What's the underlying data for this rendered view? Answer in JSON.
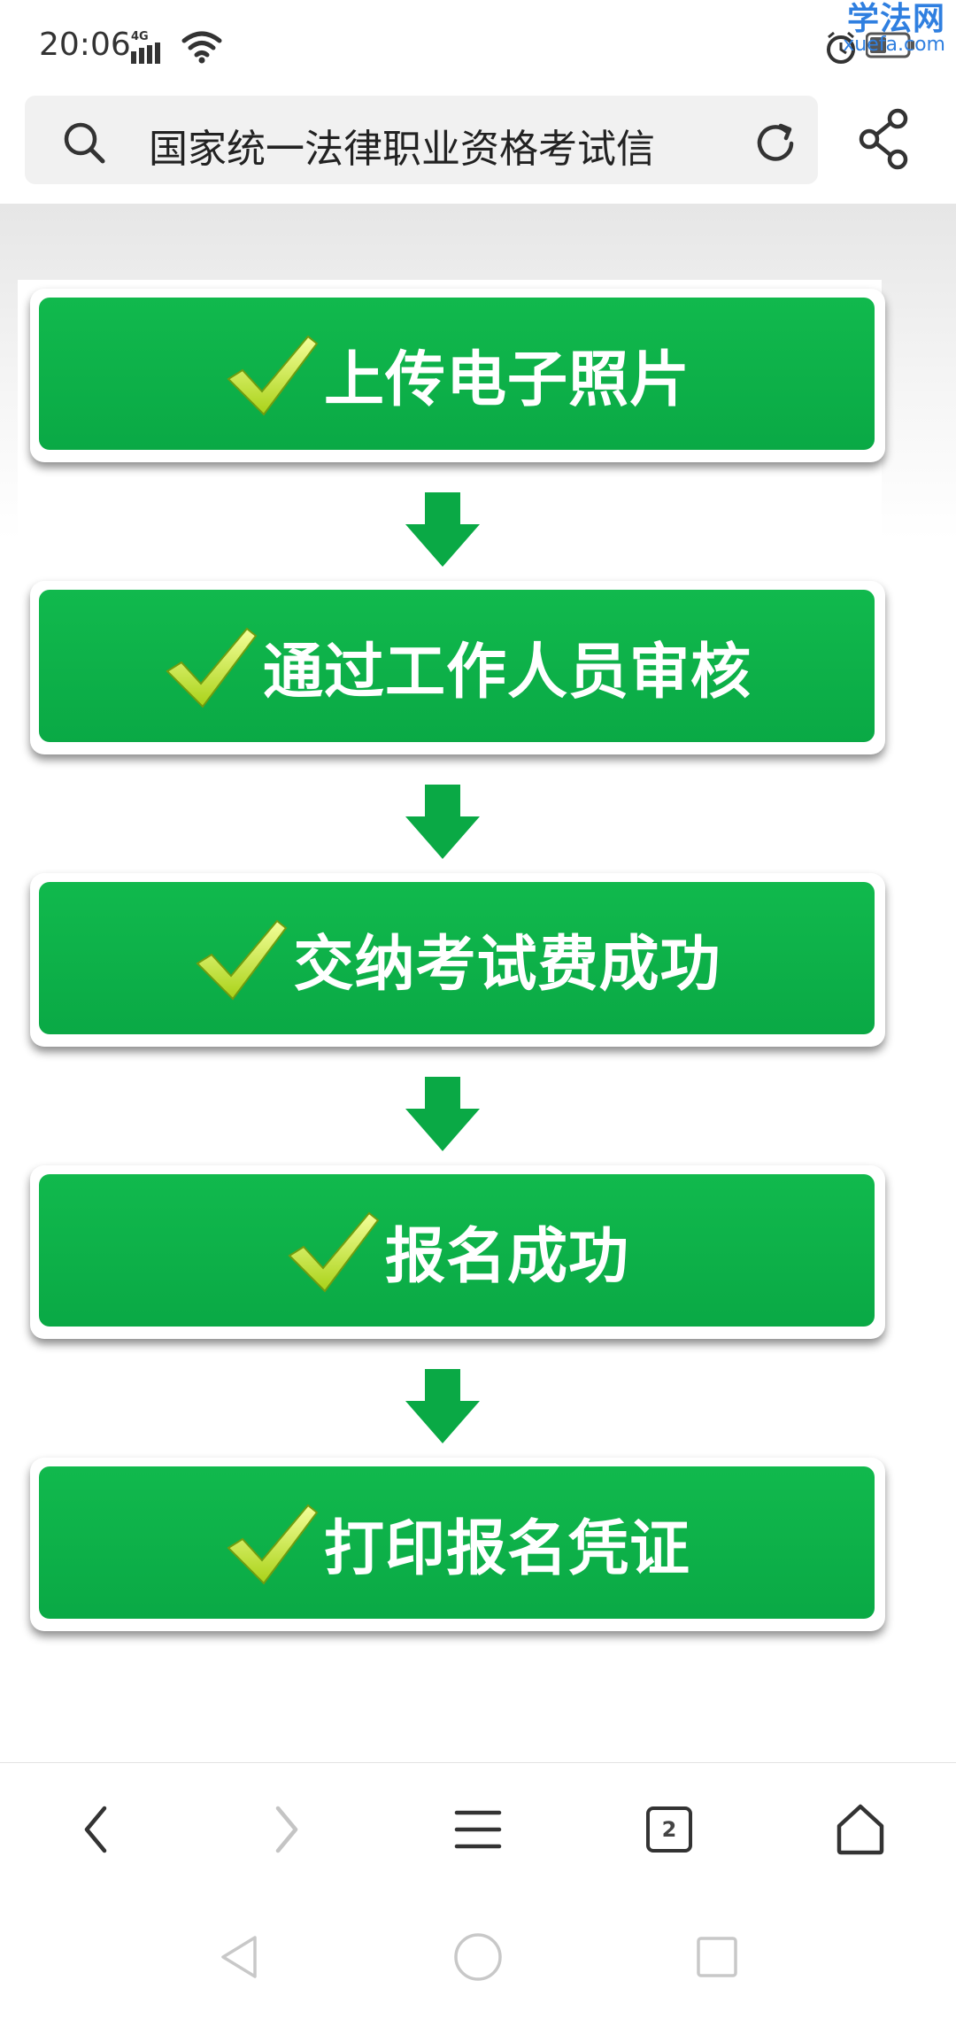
{
  "status_bar": {
    "time": "20:06",
    "network": "4G",
    "watermark_main": "学法网",
    "watermark_sub": "xuefa.com"
  },
  "address_bar": {
    "url_text": "国家统一法律职业资格考试信"
  },
  "flow": {
    "steps": [
      {
        "label": "上传电子照片"
      },
      {
        "label": "通过工作人员审核"
      },
      {
        "label": "交纳考试费成功"
      },
      {
        "label": "报名成功"
      },
      {
        "label": "打印报名凭证"
      }
    ]
  },
  "toolbar": {
    "tab_count": "2"
  },
  "colors": {
    "step_green": "#0aa945",
    "arrow_green": "#0aa945",
    "watermark_blue": "#2f7fe0"
  }
}
